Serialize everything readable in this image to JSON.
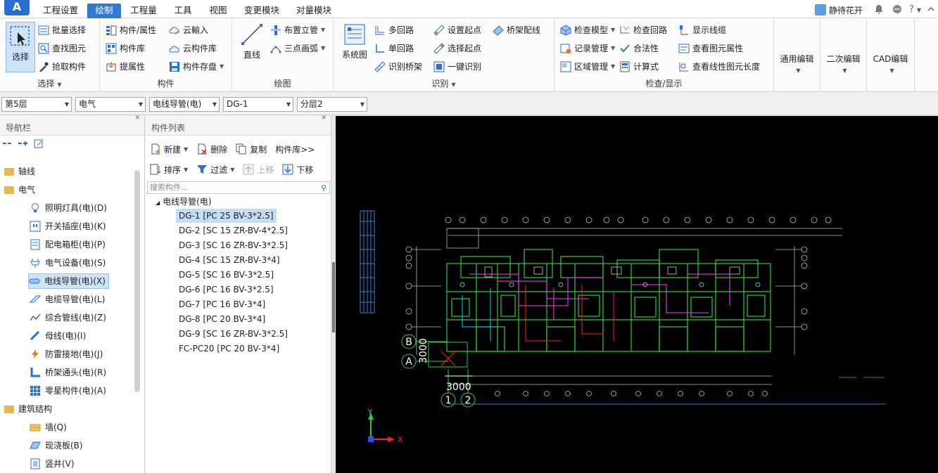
{
  "app": {
    "logo": "A"
  },
  "menu": {
    "tabs": [
      "工程设置",
      "绘制",
      "工程量",
      "工具",
      "视图",
      "变更模块",
      "对量模块"
    ],
    "active": "绘制"
  },
  "user": {
    "name": "静待花开",
    "icons": [
      "bell-icon",
      "chat-icon",
      "help-icon"
    ],
    "help": "?"
  },
  "ribbon": {
    "select_group": {
      "big": "选择",
      "items": [
        "批量选择",
        "查找图元",
        "拾取构件"
      ],
      "label": "选择"
    },
    "component_group": {
      "items": [
        "构件/属性",
        "构件库",
        "提属性",
        "云輸入",
        "云构件库",
        "构件存盘"
      ],
      "label": "构件"
    },
    "draw_group": {
      "big": "直线",
      "items": [
        "布置立管",
        "三点画弧"
      ],
      "label": "绘图"
    },
    "identify_group": {
      "big": "系统图",
      "items": [
        "多回路",
        "单回路",
        "识别桥架",
        "设置起点",
        "选择起点",
        "一键识别",
        "桥架配线"
      ],
      "label": "识别"
    },
    "check_group": {
      "items": [
        "检查模型",
        "记录管理",
        "区域管理",
        "检查回路",
        "合法性",
        "计算式",
        "显示线缆",
        "查看图元属性",
        "查看线性图元长度"
      ],
      "label": "检查/显示"
    },
    "edit_groups": [
      "通用编辑",
      "二次编辑",
      "CAD编辑"
    ]
  },
  "selectors": [
    "第5层",
    "电气",
    "电线导管(电)",
    "DG-1",
    "分层2"
  ],
  "nav": {
    "title": "导航栏",
    "categories": [
      {
        "label": "轴线"
      },
      {
        "label": "电气"
      },
      {
        "label": "建筑结构"
      }
    ],
    "electric_items": [
      "照明灯具(电)(D)",
      "开关插座(电)(K)",
      "配电箱柜(电)(P)",
      "电气设备(电)(S)",
      "电线导管(电)(X)",
      "电缆导管(电)(L)",
      "综合管线(电)(Z)",
      "母线(电)(I)",
      "防雷接地(电)(J)",
      "桥架通头(电)(R)",
      "零星构件(电)(A)"
    ],
    "structure_items": [
      "墙(Q)",
      "现浇板(B)",
      "竖井(V)"
    ],
    "active": "电线导管(电)(X)"
  },
  "component_list": {
    "title": "构件列表",
    "toolbar1": [
      "新建",
      "删除",
      "复制",
      "构件库>>"
    ],
    "toolbar2": [
      "排序",
      "过滤",
      "上移",
      "下移"
    ],
    "search_placeholder": "搜索构件...",
    "root": "电线导管(电)",
    "items": [
      "DG-1 [PC 25 BV-3*2.5]",
      "DG-2 [SC 15 ZR-BV-4*2.5]",
      "DG-3 [SC 16 ZR-BV-3*2.5]",
      "DG-4 [SC 15 ZR-BV-3*4]",
      "DG-5 [SC 16 BV-3*2.5]",
      "DG-6 [PC 16 BV-3*2.5]",
      "DG-7 [PC 16 BV-3*4]",
      "DG-8 [PC 20 BV-3*4]",
      "DG-9 [SC 16 ZR-BV-3*2.5]",
      "FC-PC20 [PC 20 BV-3*4]"
    ],
    "active": "DG-1 [PC 25 BV-3*2.5]"
  },
  "canvas": {
    "axis_labels": [
      "B",
      "A",
      "1",
      "2"
    ],
    "dim_vertical": "3000",
    "dim_horizontal": "3000",
    "ucs_x": "X",
    "ucs_y": "Y"
  },
  "colors": {
    "accent": "#2f7ad3",
    "canvas_bg": "#000000",
    "wall": "#2ecc40",
    "axis": "#ffffff"
  }
}
